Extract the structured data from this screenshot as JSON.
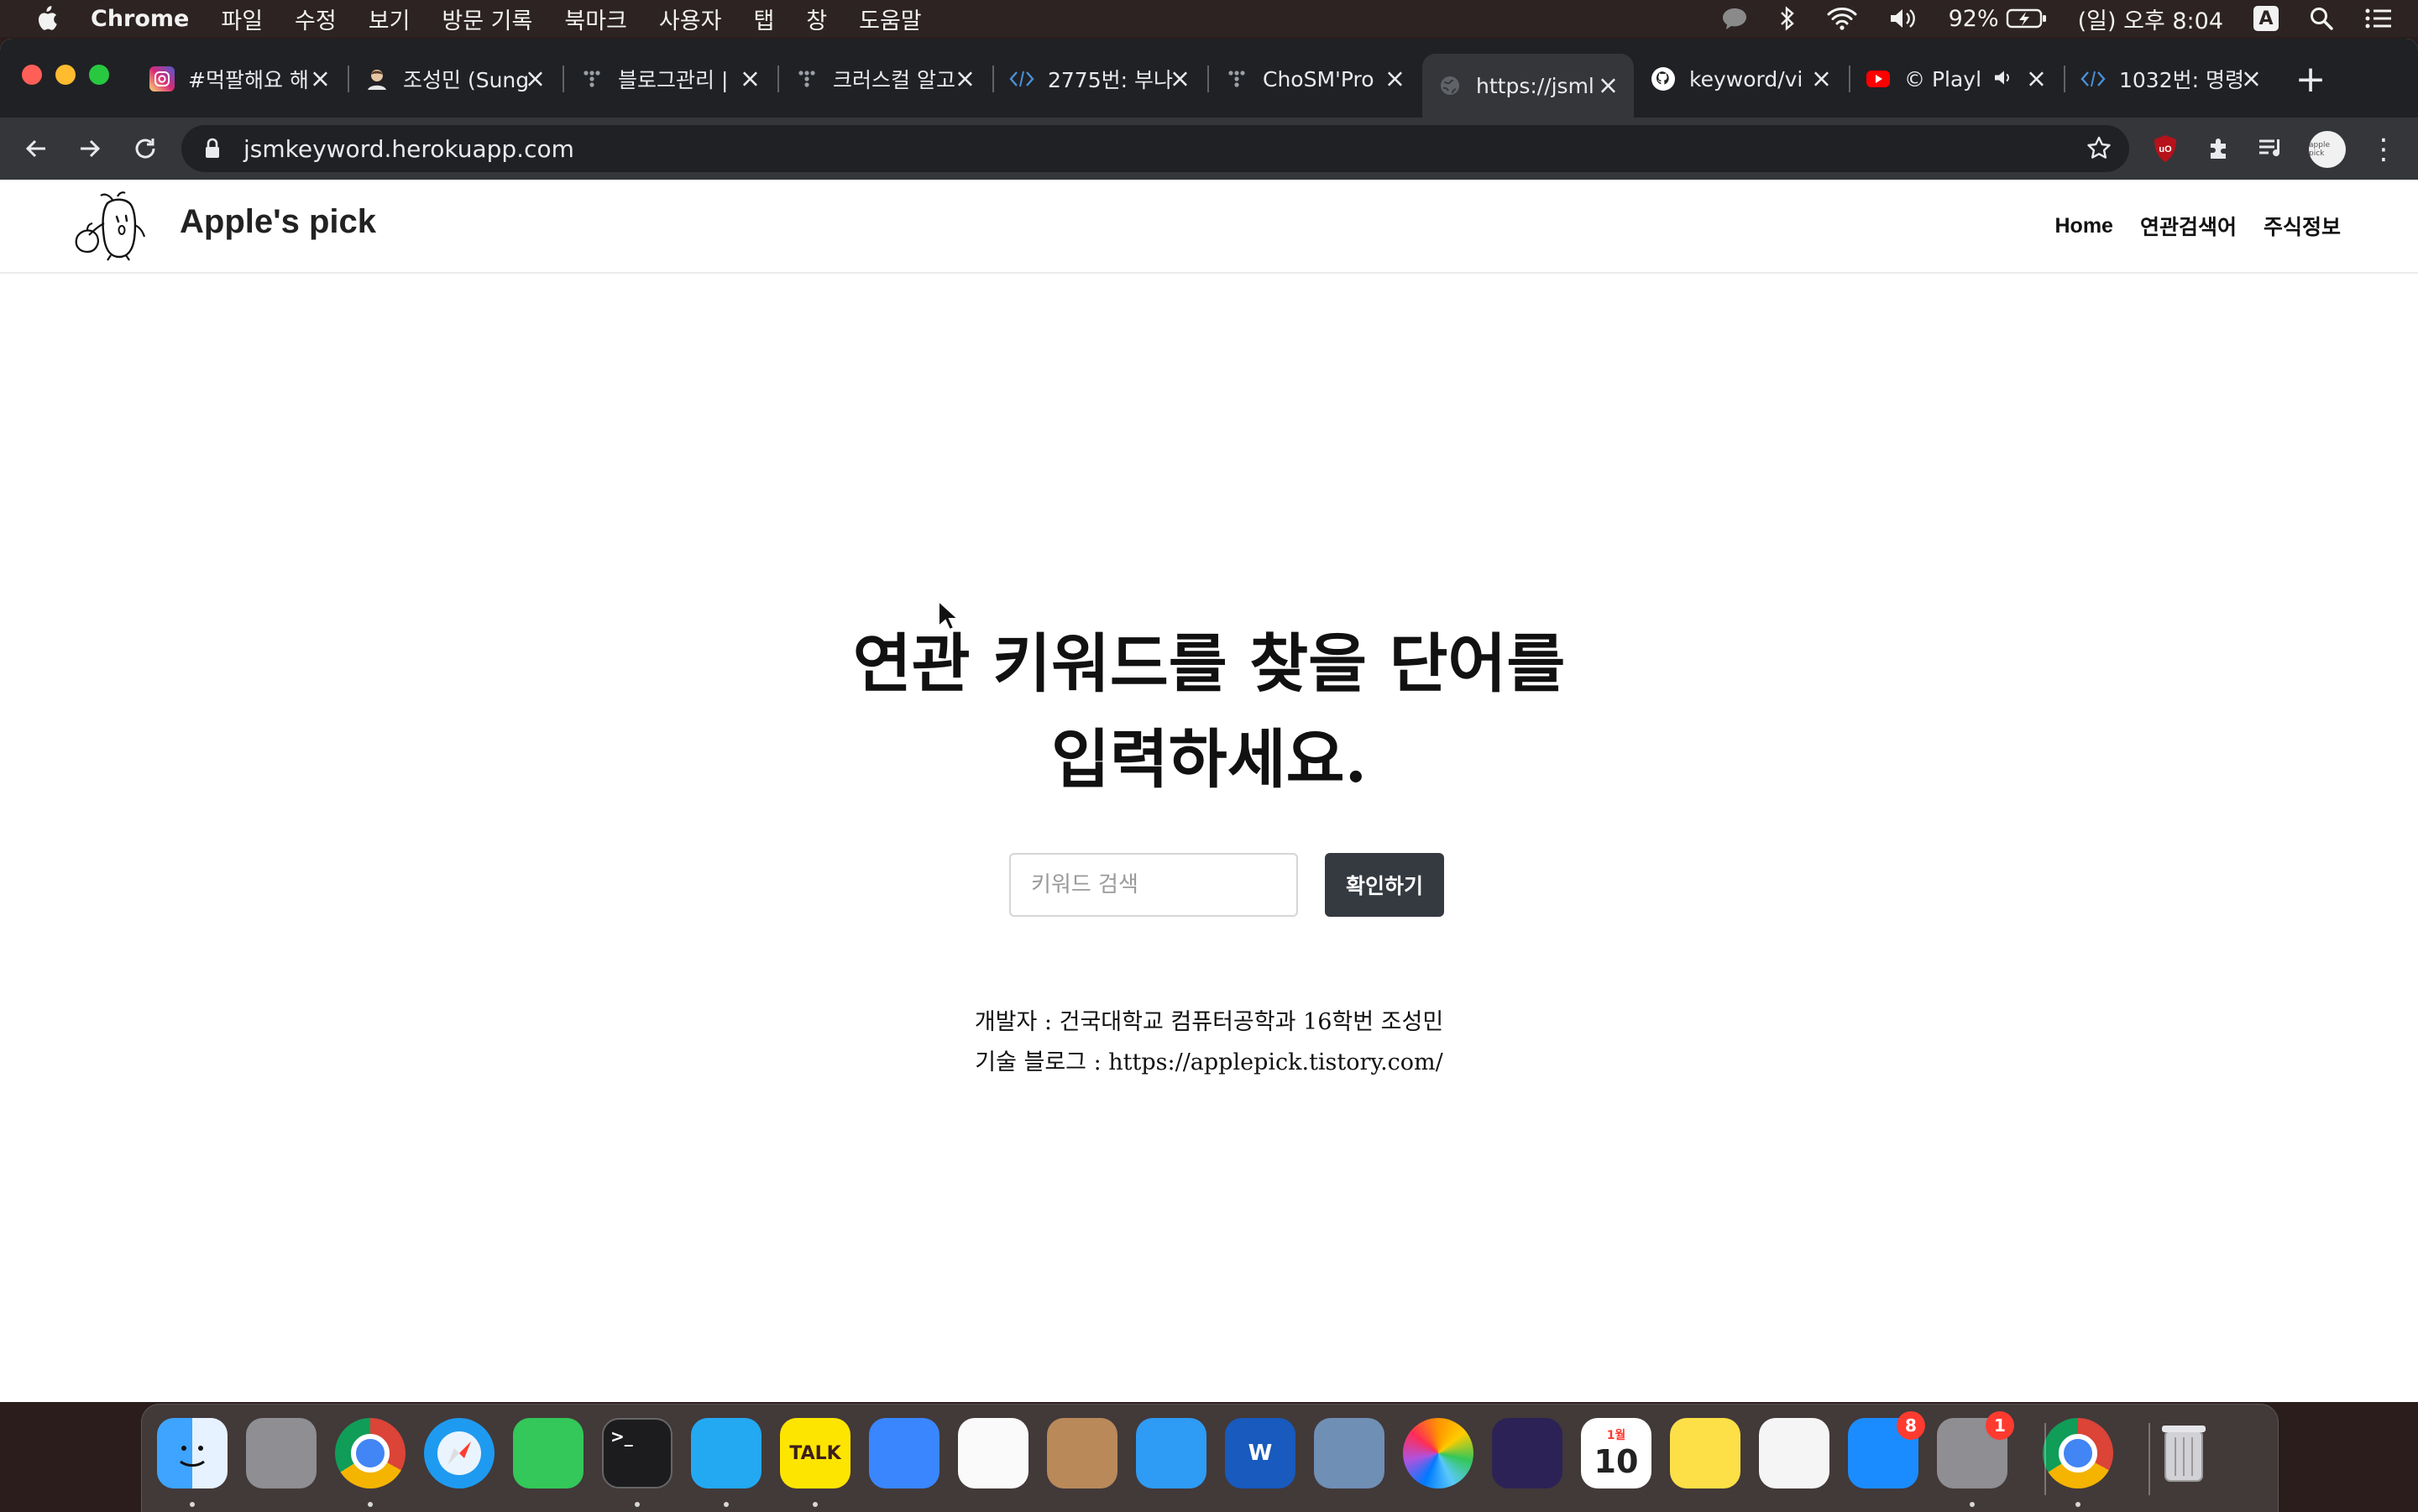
{
  "menubar": {
    "app_name": "Chrome",
    "items": [
      "파일",
      "수정",
      "보기",
      "방문 기록",
      "북마크",
      "사용자",
      "탭",
      "창",
      "도움말"
    ],
    "battery": "92%",
    "clock": "(일) 오후 8:04",
    "input_source": "A"
  },
  "tabs": [
    {
      "title": "#먹팔해요 해",
      "favicon": "instagram-icon",
      "color": "#d6249f"
    },
    {
      "title": "조성민 (Sung",
      "favicon": "avatar-icon",
      "color": "#c49a6c"
    },
    {
      "title": "블로그관리 |",
      "favicon": "tistory-icon",
      "color": "#9aa0a6"
    },
    {
      "title": "크러스컬 알고",
      "favicon": "tistory-icon",
      "color": "#9aa0a6"
    },
    {
      "title": "2775번: 부나",
      "favicon": "code-icon",
      "color": "#4a90d9"
    },
    {
      "title": "ChoSM'Pro",
      "favicon": "tistory-icon",
      "color": "#9aa0a6"
    },
    {
      "title": "https://jsml",
      "favicon": "globe-icon",
      "color": "#8a8d91",
      "active": true
    },
    {
      "title": "keyword/vi",
      "favicon": "github-icon",
      "color": "#ffffff"
    },
    {
      "title": "© Playl",
      "favicon": "youtube-icon",
      "color": "#ff0000"
    },
    {
      "title": "1032번: 명령",
      "favicon": "code-icon",
      "color": "#4a90d9"
    }
  ],
  "address_bar": {
    "url": "jsmkeyword.herokuapp.com"
  },
  "profile_label": "apple pick",
  "site": {
    "brand": "Apple's pick",
    "nav": [
      "Home",
      "연관검색어",
      "주식정보"
    ],
    "headline_line1": "연관 키워드를 찾을 단어를",
    "headline_line2": "입력하세요.",
    "search": {
      "placeholder": "키워드 검색",
      "value": ""
    },
    "submit_label": "확인하기",
    "developer": "개발자 : 건국대학교 컴퓨터공학과 16학번 조성민",
    "blog_label": "기술 블로그 : ",
    "blog_url": "https://applepick.tistory.com/"
  },
  "dock": {
    "apps": [
      {
        "name": "finder",
        "color": "#1e88e5",
        "dot": true
      },
      {
        "name": "launchpad",
        "color": "#8e8e93",
        "dot": false
      },
      {
        "name": "chrome",
        "color": "#ffffff",
        "dot": true
      },
      {
        "name": "safari",
        "color": "#1e9bf0",
        "dot": false
      },
      {
        "name": "facetime",
        "color": "#34c759",
        "dot": false
      },
      {
        "name": "terminal",
        "color": "#1c1c1e",
        "dot": true,
        "label": ">_"
      },
      {
        "name": "vscode",
        "color": "#23a9f2",
        "dot": true
      },
      {
        "name": "kakaotalk",
        "color": "#fee500",
        "dot": true,
        "label": "TALK"
      },
      {
        "name": "xcode-instruments",
        "color": "#3a86ff",
        "dot": false
      },
      {
        "name": "pages",
        "color": "#fafafa",
        "dot": false
      },
      {
        "name": "contacts",
        "color": "#b9895a",
        "dot": false
      },
      {
        "name": "messages",
        "color": "#2e9bf4",
        "dot": false
      },
      {
        "name": "word",
        "color": "#185abd",
        "dot": false,
        "label": "W"
      },
      {
        "name": "preview",
        "color": "#6f8fb5",
        "dot": false
      },
      {
        "name": "photos",
        "color": "#f4f4f4",
        "dot": false
      },
      {
        "name": "eclipse",
        "color": "#2c2255",
        "dot": false
      },
      {
        "name": "calendar",
        "color": "#ffffff",
        "dot": false,
        "label": "10",
        "sublabel": "1월"
      },
      {
        "name": "notes",
        "color": "#fde047",
        "dot": false
      },
      {
        "name": "keynote",
        "color": "#f5f5f5",
        "dot": false
      },
      {
        "name": "app-store",
        "color": "#1a8cff",
        "dot": false,
        "badge": "8"
      },
      {
        "name": "system-preferences",
        "color": "#8e8e93",
        "dot": true,
        "badge": "1"
      },
      {
        "name": "chrome-2",
        "color": "#ffffff",
        "dot": true
      },
      {
        "name": "trash",
        "color": "#c7c7cc",
        "dot": false
      }
    ]
  }
}
